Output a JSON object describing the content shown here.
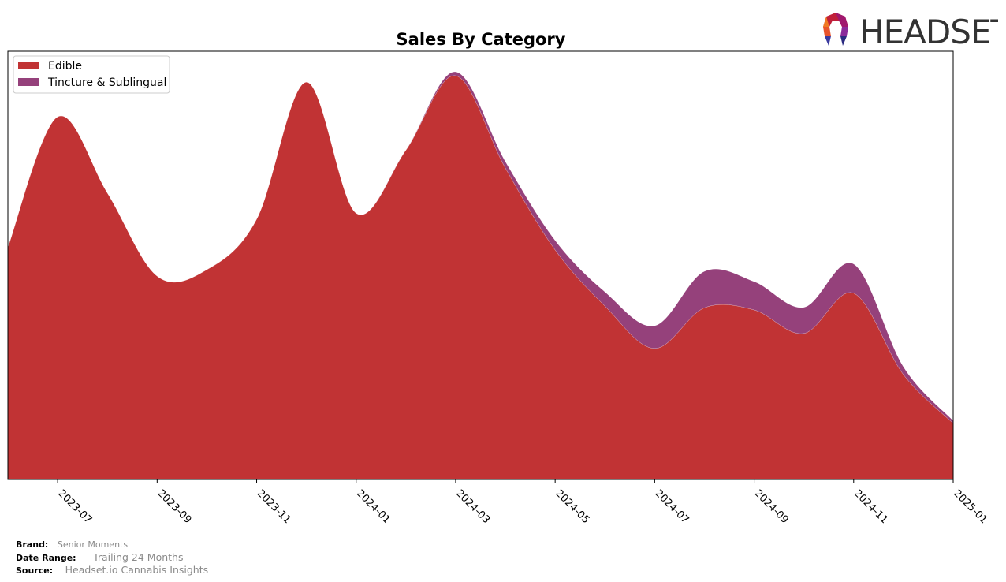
{
  "header": {
    "logo_text": "HEADSET"
  },
  "chart_data": {
    "type": "area",
    "stacked": true,
    "title": "Sales By Category",
    "xlabel": "",
    "ylabel": "",
    "x": [
      "2023-06",
      "2023-07",
      "2023-08",
      "2023-09",
      "2023-10",
      "2023-11",
      "2023-12",
      "2024-01",
      "2024-02",
      "2024-03",
      "2024-04",
      "2024-05",
      "2024-06",
      "2024-07",
      "2024-08",
      "2024-09",
      "2024-10",
      "2024-11",
      "2024-12",
      "2025-01"
    ],
    "xticks": [
      "2023-07",
      "2023-09",
      "2023-11",
      "2024-01",
      "2024-03",
      "2024-05",
      "2024-07",
      "2024-09",
      "2024-11",
      "2025-01"
    ],
    "ylim": [
      0,
      100
    ],
    "y_axis_labels_shown": false,
    "grid": false,
    "legend_position": "top-left",
    "series": [
      {
        "name": "Edible",
        "color": "#C13334",
        "values": [
          54.3,
          84.7,
          66.9,
          47.5,
          49.0,
          60.8,
          92.8,
          62.2,
          76.9,
          94.3,
          72.7,
          53.6,
          40.5,
          30.6,
          40.1,
          39.6,
          34.1,
          43.5,
          24.5,
          13.1
        ]
      },
      {
        "name": "Tincture & Sublingual",
        "color": "#95417B",
        "values": [
          0,
          0,
          0,
          0,
          0,
          0,
          0,
          0,
          0,
          0.9,
          1.5,
          2.2,
          3.3,
          5.3,
          8.5,
          6.6,
          6.1,
          6.8,
          1.8,
          0.6
        ]
      }
    ]
  },
  "footer": {
    "brand_label": "Brand:",
    "brand_value": "Senior Moments",
    "date_range_label": "Date Range:",
    "date_range_value": "Trailing 24 Months",
    "source_label": "Source:",
    "source_value": "Headset.io Cannabis Insights"
  }
}
